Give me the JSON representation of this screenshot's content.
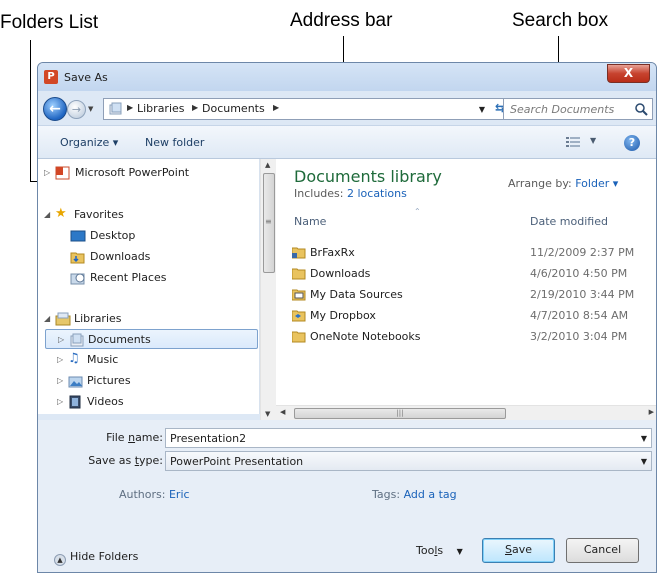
{
  "callouts": {
    "folders_list": "Folders List",
    "address_bar": "Address bar",
    "search_box": "Search box"
  },
  "window": {
    "title": "Save As",
    "close_label": "X"
  },
  "address": {
    "crumbs": [
      "Libraries",
      "Documents"
    ]
  },
  "search": {
    "placeholder": "Search Documents"
  },
  "toolbar": {
    "organize_label": "Organize ▾",
    "new_folder_label": "New folder",
    "help_label": "?"
  },
  "nav": {
    "items": [
      {
        "label": "Microsoft PowerPoint"
      },
      {
        "label": "Favorites"
      },
      {
        "label": "Desktop"
      },
      {
        "label": "Downloads"
      },
      {
        "label": "Recent Places"
      },
      {
        "label": "Libraries"
      },
      {
        "label": "Documents"
      },
      {
        "label": "Music"
      },
      {
        "label": "Pictures"
      },
      {
        "label": "Videos"
      }
    ]
  },
  "library": {
    "title": "Documents library",
    "includes_label": "Includes:",
    "includes_link": "2 locations",
    "arrange_label": "Arrange by:",
    "arrange_value": "Folder ▾"
  },
  "columns": {
    "name": "Name",
    "date": "Date modified"
  },
  "files": [
    {
      "name": "BrFaxRx",
      "date": "11/2/2009 2:37 PM"
    },
    {
      "name": "Downloads",
      "date": "4/6/2010 4:50 PM"
    },
    {
      "name": "My Data Sources",
      "date": "2/19/2010 3:44 PM"
    },
    {
      "name": "My Dropbox",
      "date": "4/7/2010 8:54 AM"
    },
    {
      "name": "OneNote Notebooks",
      "date": "3/2/2010 3:04 PM"
    }
  ],
  "form": {
    "file_name_label_pre": "File ",
    "file_name_label_u": "n",
    "file_name_label_post": "ame:",
    "file_name_value": "Presentation2",
    "save_type_label_pre": "Save as ",
    "save_type_label_u": "t",
    "save_type_label_post": "ype:",
    "save_type_value": "PowerPoint Presentation",
    "authors_label": "Authors:",
    "authors_value": "Eric",
    "tags_label": "Tags:",
    "tags_value": "Add a tag"
  },
  "footer": {
    "hide_folders_label": "Hide Folders",
    "tools_label_pre": "Too",
    "tools_label_u": "l",
    "tools_label_post": "s",
    "save_label_u": "S",
    "save_label_post": "ave",
    "cancel_label": "Cancel"
  },
  "colors": {
    "accent_link": "#1a62b9",
    "library_title": "#1e6a3a",
    "window_frame": "#dde8f5"
  }
}
